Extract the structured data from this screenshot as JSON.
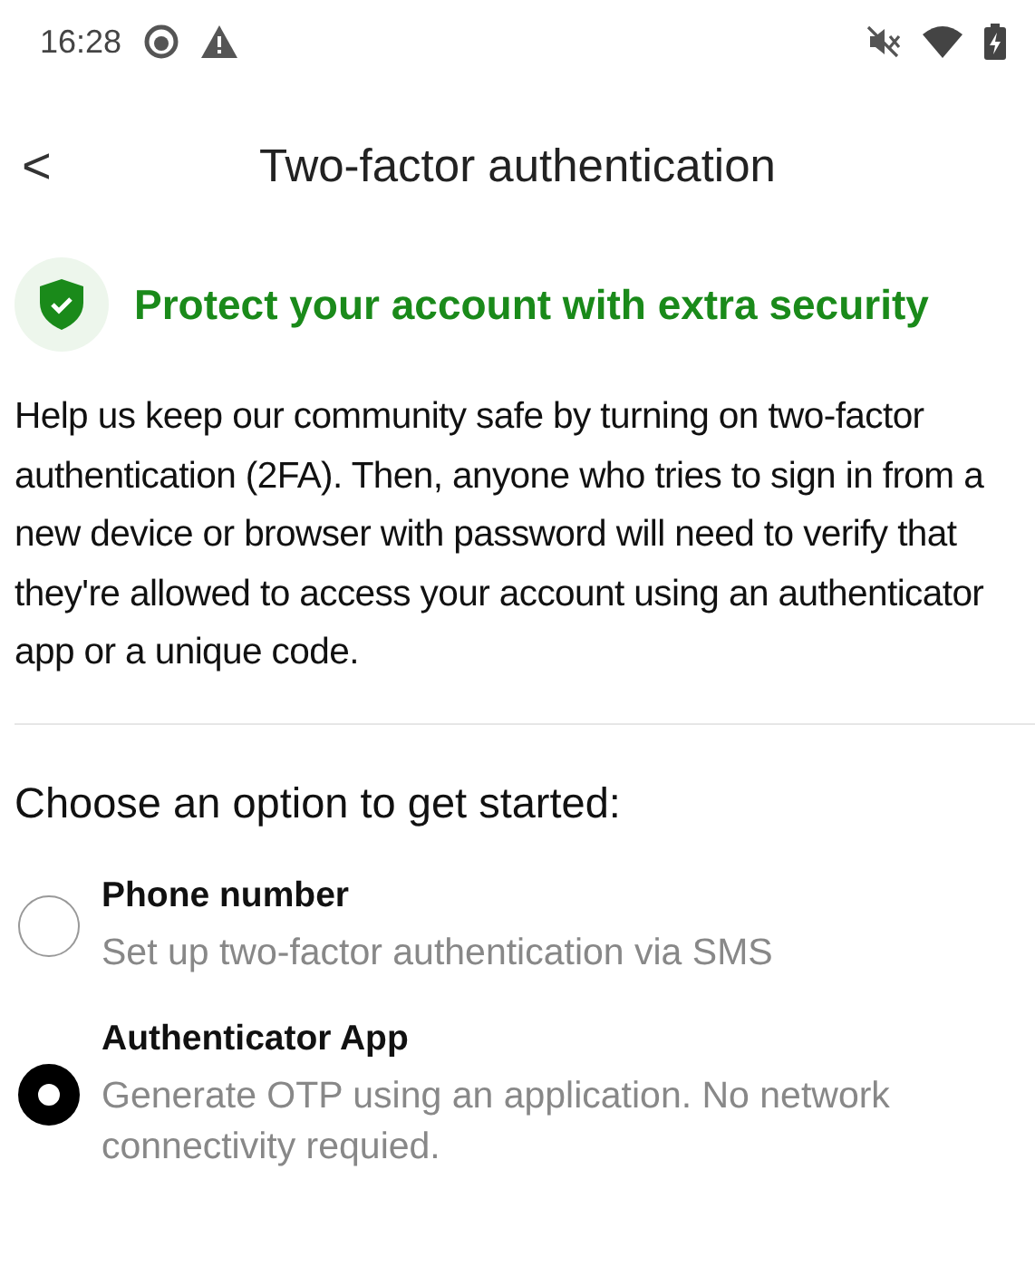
{
  "status_bar": {
    "time": "16:28"
  },
  "header": {
    "back": "<",
    "title": "Two-factor authentication"
  },
  "banner": {
    "title": "Protect your account with extra security"
  },
  "description": "Help us keep our community safe by turning on two-factor authentication (2FA). Then, anyone who tries to sign in from a new device or browser with password will need to verify that they're allowed to access your account using an authenticator app or a unique code.",
  "section_title": "Choose an option to get started:",
  "options": [
    {
      "label": "Phone number",
      "description": "Set up two-factor authentication via SMS",
      "selected": false
    },
    {
      "label": "Authenticator App",
      "description": "Generate OTP using an application. No network connectivity requied.",
      "selected": true
    }
  ]
}
